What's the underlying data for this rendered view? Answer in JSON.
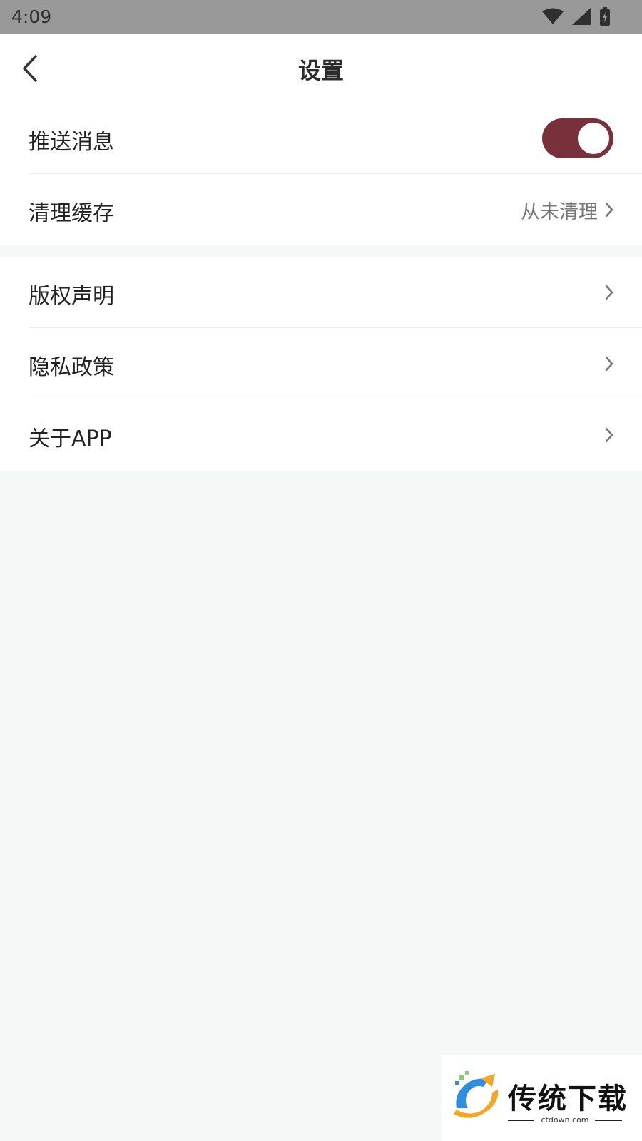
{
  "status_bar": {
    "time": "4:09",
    "icons": [
      "wifi-icon",
      "signal-icon",
      "battery-charging-icon"
    ]
  },
  "header": {
    "title": "设置",
    "back_icon": "back-chevron-icon"
  },
  "settings": {
    "group1": [
      {
        "label": "推送消息",
        "type": "toggle",
        "on": true
      },
      {
        "label": "清理缓存",
        "value": "从未清理",
        "type": "link"
      }
    ],
    "group2": [
      {
        "label": "版权声明",
        "type": "link"
      },
      {
        "label": "隐私政策",
        "type": "link"
      },
      {
        "label": "关于APP",
        "type": "link"
      }
    ]
  },
  "watermark": {
    "text": "传统下载",
    "url": "ctdown.com"
  },
  "colors": {
    "accent": "#78303a",
    "status_bar": "#999999",
    "background": "#f6f7f7"
  }
}
